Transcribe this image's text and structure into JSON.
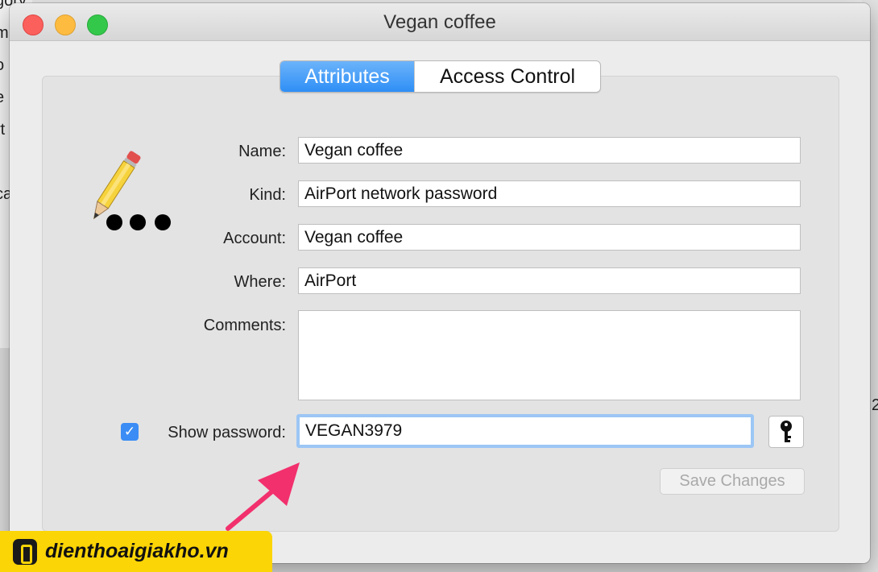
{
  "window": {
    "title": "Vegan coffee"
  },
  "tabs": [
    {
      "label": "Attributes"
    },
    {
      "label": "Access Control"
    }
  ],
  "fields": {
    "name": {
      "label": "Name:",
      "value": "Vegan coffee"
    },
    "kind": {
      "label": "Kind:",
      "value": "AirPort network password"
    },
    "account": {
      "label": "Account:",
      "value": "Vegan coffee"
    },
    "where": {
      "label": "Where:",
      "value": "AirPort"
    },
    "comments": {
      "label": "Comments:",
      "value": ""
    }
  },
  "password": {
    "show_label": "Show password:",
    "show_checked": true,
    "value": "VEGAN3979"
  },
  "buttons": {
    "save_changes": "Save Changes"
  },
  "icons": {
    "item": "pencil-dots-icon",
    "key": "key-icon"
  },
  "background": {
    "left_fragments": [
      "gory",
      "m",
      "o",
      "e",
      "rt",
      "ca"
    ],
    "right_fragment": "2"
  },
  "watermark": {
    "text": "dienthoaigiakho.vn"
  },
  "colors": {
    "accent": "#3b8df5",
    "arrow": "#f2306d",
    "watermark_bg": "#fbd506"
  }
}
